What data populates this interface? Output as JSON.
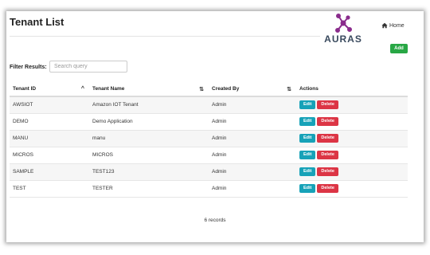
{
  "header": {
    "title": "Tenant List",
    "logo_text": "AURAS",
    "home_label": "Home"
  },
  "toolbar": {
    "add_label": "Add"
  },
  "filter": {
    "label": "Filter Results:",
    "placeholder": "Search query",
    "value": ""
  },
  "table": {
    "columns": [
      "Tenant ID",
      "Tenant Name",
      "Created By",
      "Actions"
    ],
    "sort": {
      "column": "Tenant ID",
      "direction": "ascending"
    },
    "rows": [
      {
        "id": "AWSIOT",
        "name": "Amazon IOT Tenant",
        "created_by": "Admin",
        "edit": "Edit",
        "delete": "Delete"
      },
      {
        "id": "DEMO",
        "name": "Demo Application",
        "created_by": "Admin",
        "edit": "Edit",
        "delete": "Delete"
      },
      {
        "id": "MANU",
        "name": "manu",
        "created_by": "Admin",
        "edit": "Edit",
        "delete": "Delete"
      },
      {
        "id": "MICROS",
        "name": "MICROS",
        "created_by": "Admin",
        "edit": "Edit",
        "delete": "Delete"
      },
      {
        "id": "SAMPLE",
        "name": "TEST123",
        "created_by": "Admin",
        "edit": "Edit",
        "delete": "Delete"
      },
      {
        "id": "TEST",
        "name": "TESTER",
        "created_by": "Admin",
        "edit": "Edit",
        "delete": "Delete"
      }
    ]
  },
  "footer": {
    "records_label": "6 records"
  },
  "colors": {
    "add": "#28a745",
    "edit": "#17a2b8",
    "delete": "#dc3545",
    "logo_accent": "#8a2c8c"
  },
  "icons": {
    "home": "home-icon",
    "sort_asc": "chevron-up-icon",
    "sort": "sort-arrows-icon"
  }
}
